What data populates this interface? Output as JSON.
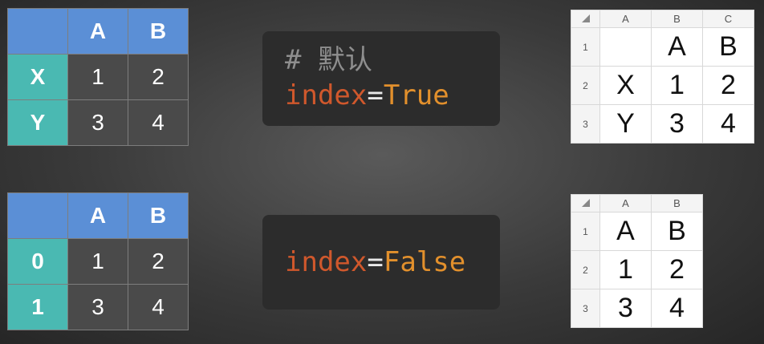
{
  "df_index_true": {
    "columns": [
      "A",
      "B"
    ],
    "rows": [
      {
        "index": "X",
        "values": [
          "1",
          "2"
        ]
      },
      {
        "index": "Y",
        "values": [
          "3",
          "4"
        ]
      }
    ]
  },
  "df_index_false": {
    "columns": [
      "A",
      "B"
    ],
    "rows": [
      {
        "index": "0",
        "values": [
          "1",
          "2"
        ]
      },
      {
        "index": "1",
        "values": [
          "3",
          "4"
        ]
      }
    ]
  },
  "code_true": {
    "comment": "# 默认",
    "param": "index",
    "equals": "=",
    "value": "True"
  },
  "code_false": {
    "param": "index",
    "equals": "=",
    "value": "False"
  },
  "sheet_true": {
    "col_headers": [
      "A",
      "B",
      "C"
    ],
    "row_numbers": [
      "1",
      "2",
      "3"
    ],
    "cells": [
      [
        "",
        "A",
        "B"
      ],
      [
        "X",
        "1",
        "2"
      ],
      [
        "Y",
        "3",
        "4"
      ]
    ]
  },
  "sheet_false": {
    "col_headers": [
      "A",
      "B"
    ],
    "row_numbers": [
      "1",
      "2",
      "3"
    ],
    "cells": [
      [
        "A",
        "B"
      ],
      [
        "1",
        "2"
      ],
      [
        "3",
        "4"
      ]
    ]
  },
  "colors": {
    "header_blue": "#5b8fd6",
    "index_teal": "#4ab9b2",
    "keyword_orange": "#d0582c",
    "value_orange": "#e2902c"
  }
}
